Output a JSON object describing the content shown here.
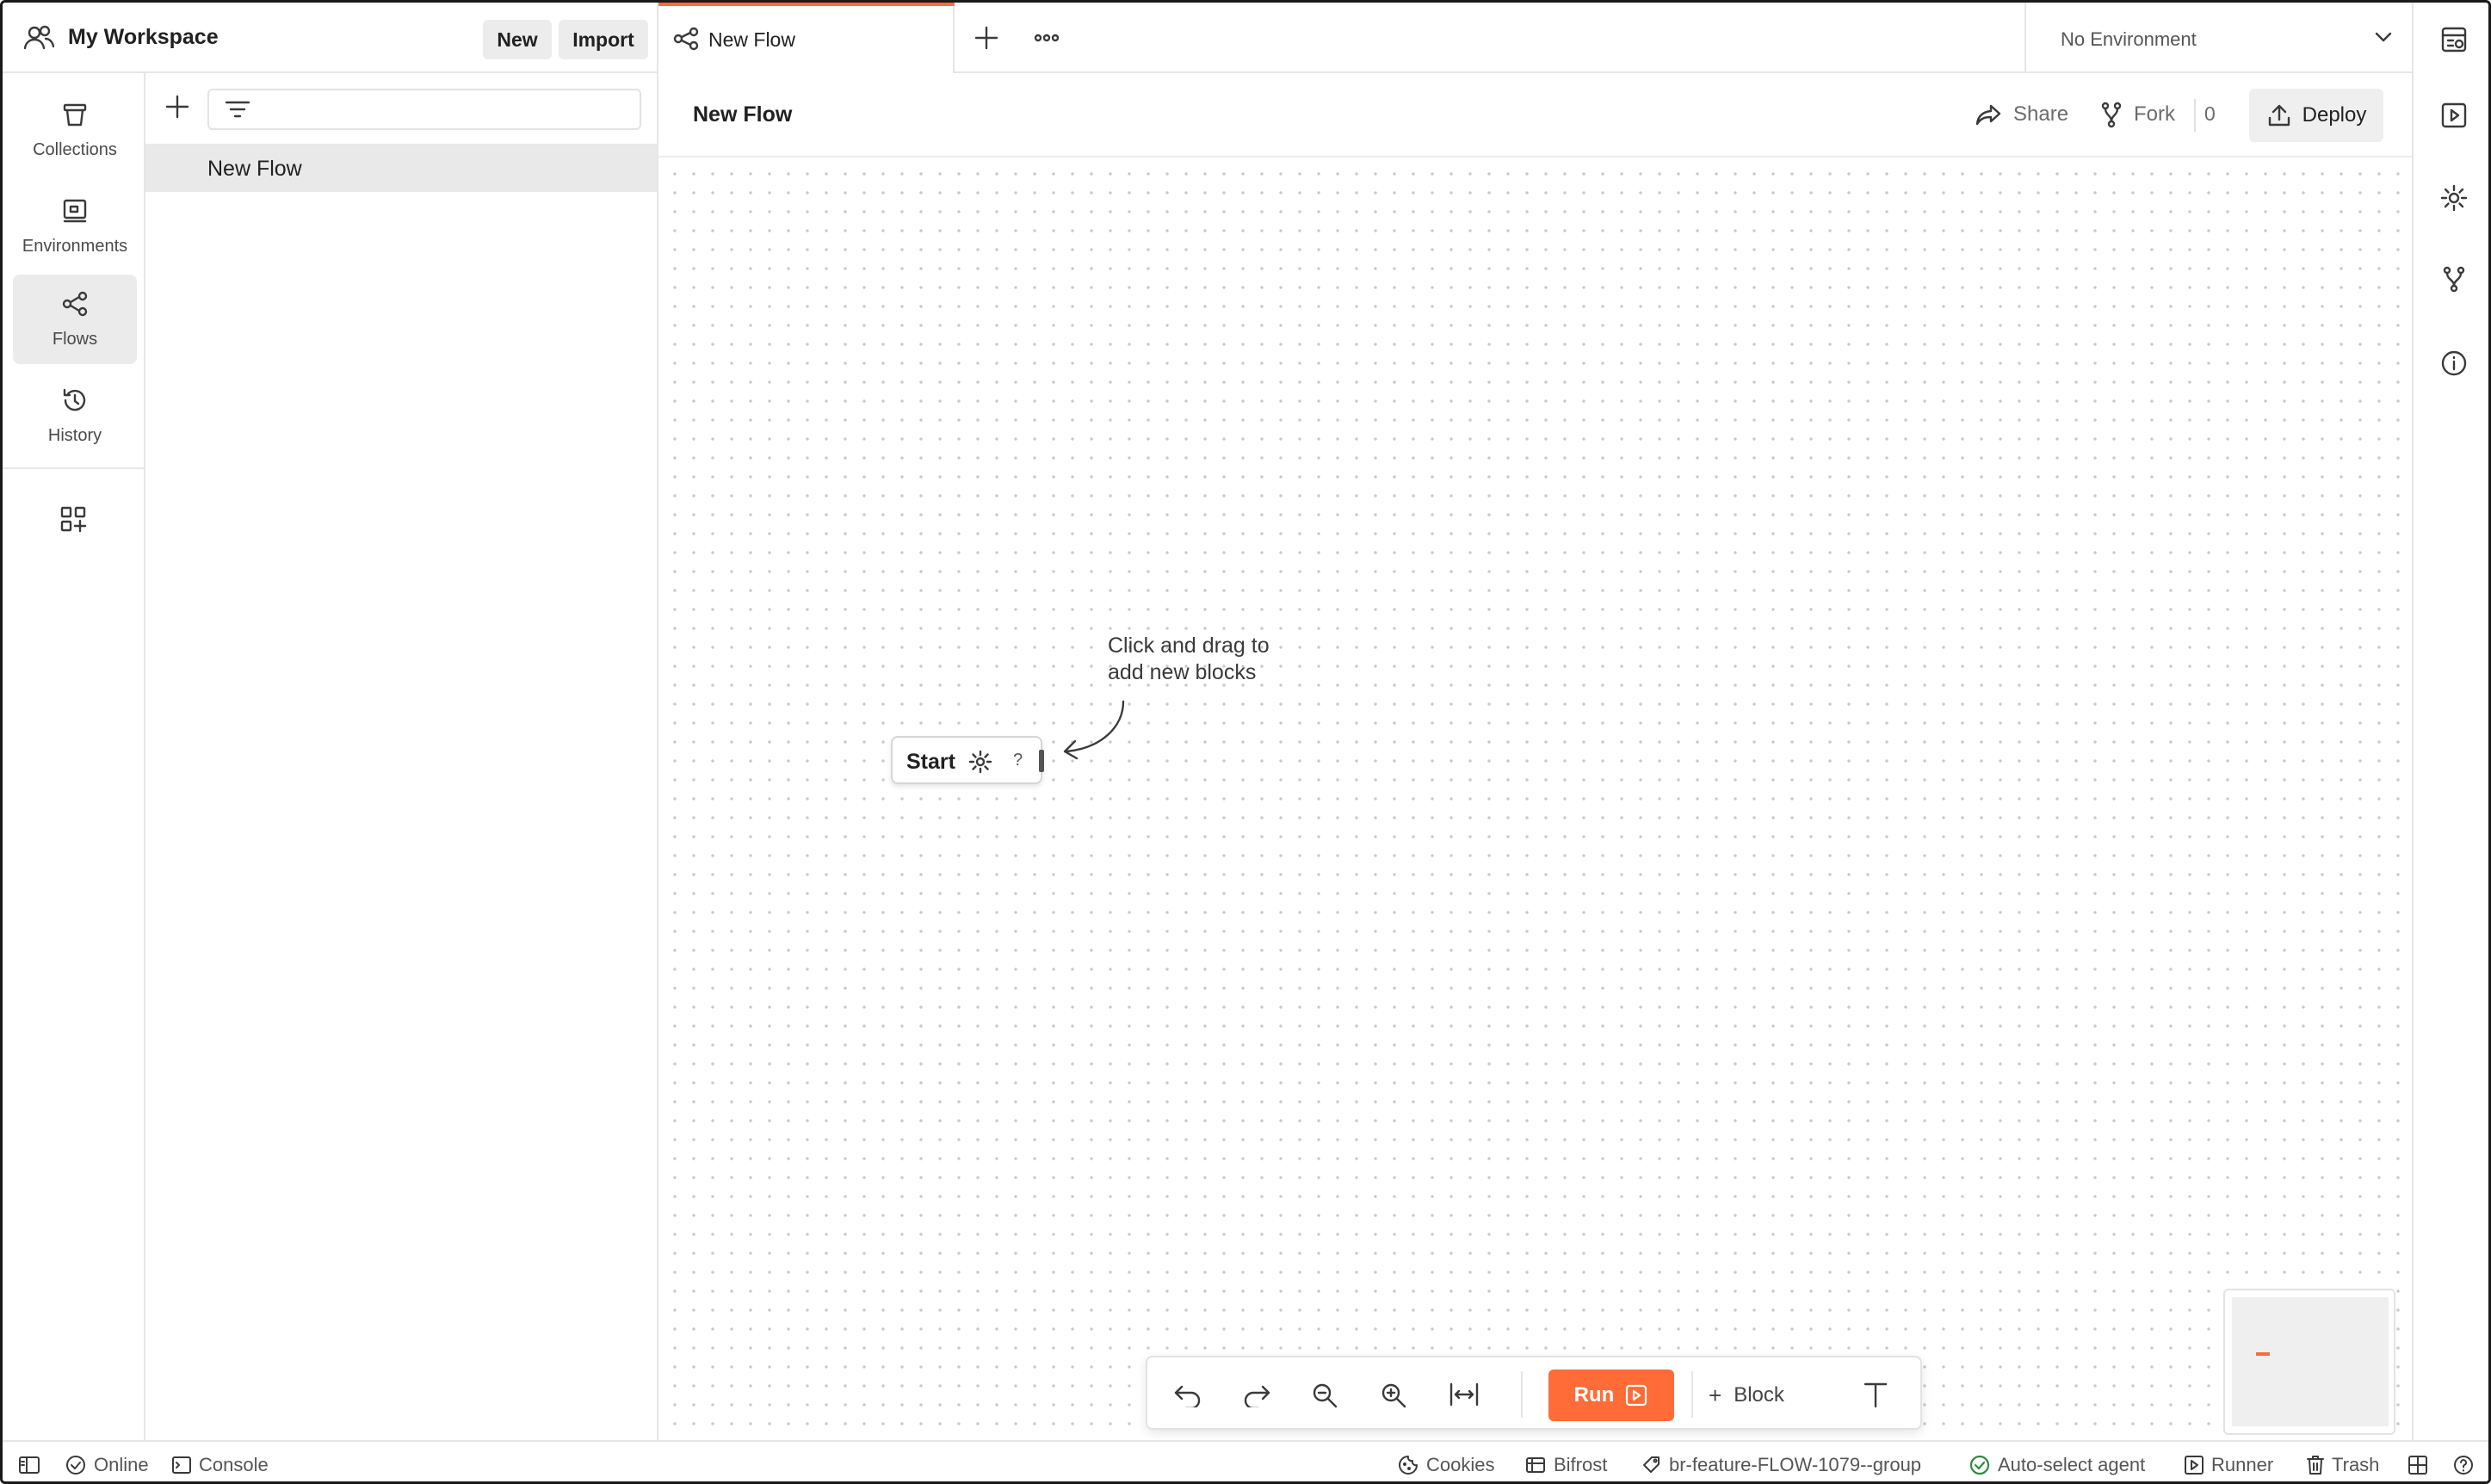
{
  "workspace": {
    "title": "My Workspace",
    "new_label": "New",
    "import_label": "Import"
  },
  "nav": {
    "items": [
      {
        "label": "Collections",
        "icon": "trash-can-icon"
      },
      {
        "label": "Environments",
        "icon": "environment-icon"
      },
      {
        "label": "Flows",
        "icon": "flows-icon",
        "active": true
      },
      {
        "label": "History",
        "icon": "history-icon"
      }
    ],
    "extra_icon": "add-widgets-icon"
  },
  "sidebar": {
    "search_placeholder": "",
    "items": [
      {
        "label": "New Flow",
        "selected": true
      }
    ]
  },
  "tabs": {
    "active": {
      "label": "New Flow",
      "icon": "flow-icon"
    },
    "environment": "No Environment"
  },
  "flow_header": {
    "title": "New Flow",
    "share_label": "Share",
    "fork_label": "Fork",
    "fork_count": "0",
    "deploy_label": "Deploy"
  },
  "canvas": {
    "start_block": {
      "label": "Start",
      "help": "?"
    },
    "hint_line1": "Click and drag to",
    "hint_line2": "add new blocks"
  },
  "toolbar": {
    "run_label": "Run",
    "block_label": "Block",
    "block_plus": "+"
  },
  "statusbar": {
    "online": "Online",
    "console": "Console",
    "cookies": "Cookies",
    "bifrost": "Bifrost",
    "branch": "br-feature-FLOW-1079--group",
    "agent": "Auto-select agent",
    "runner": "Runner",
    "trash": "Trash"
  },
  "colors": {
    "accent": "#ff6c37",
    "online_check": "#2e8a3e",
    "agent_check": "#2e8a3e"
  }
}
